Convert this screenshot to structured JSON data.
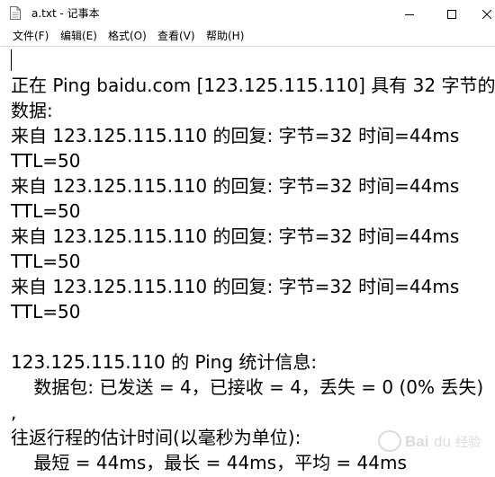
{
  "window": {
    "title": "a.txt - 记事本"
  },
  "menu": {
    "items": [
      "文件(F)",
      "编辑(E)",
      "格式(O)",
      "查看(V)",
      "帮助(H)"
    ]
  },
  "editor": {
    "lines": [
      "",
      "正在 Ping baidu.com [123.125.115.110] 具有 32 字节的",
      "数据:",
      "来自 123.125.115.110 的回复: 字节=32 时间=44ms",
      "TTL=50",
      "来自 123.125.115.110 的回复: 字节=32 时间=44ms",
      "TTL=50",
      "来自 123.125.115.110 的回复: 字节=32 时间=44ms",
      "TTL=50",
      "来自 123.125.115.110 的回复: 字节=32 时间=44ms",
      "TTL=50",
      "",
      "123.125.115.110 的 Ping 统计信息:",
      "    数据包: 已发送 = 4，已接收 = 4，丢失 = 0 (0% 丢失)",
      ",",
      "往返行程的估计时间(以毫秒为单位):",
      "    最短 = 44ms，最长 = 44ms，平均 = 44ms"
    ]
  },
  "watermark": {
    "text": "Baidu 经验"
  },
  "icons": {
    "document": "notepad-document-icon",
    "minimize": "minimize-icon",
    "maximize": "maximize-icon",
    "close": "close-icon"
  }
}
